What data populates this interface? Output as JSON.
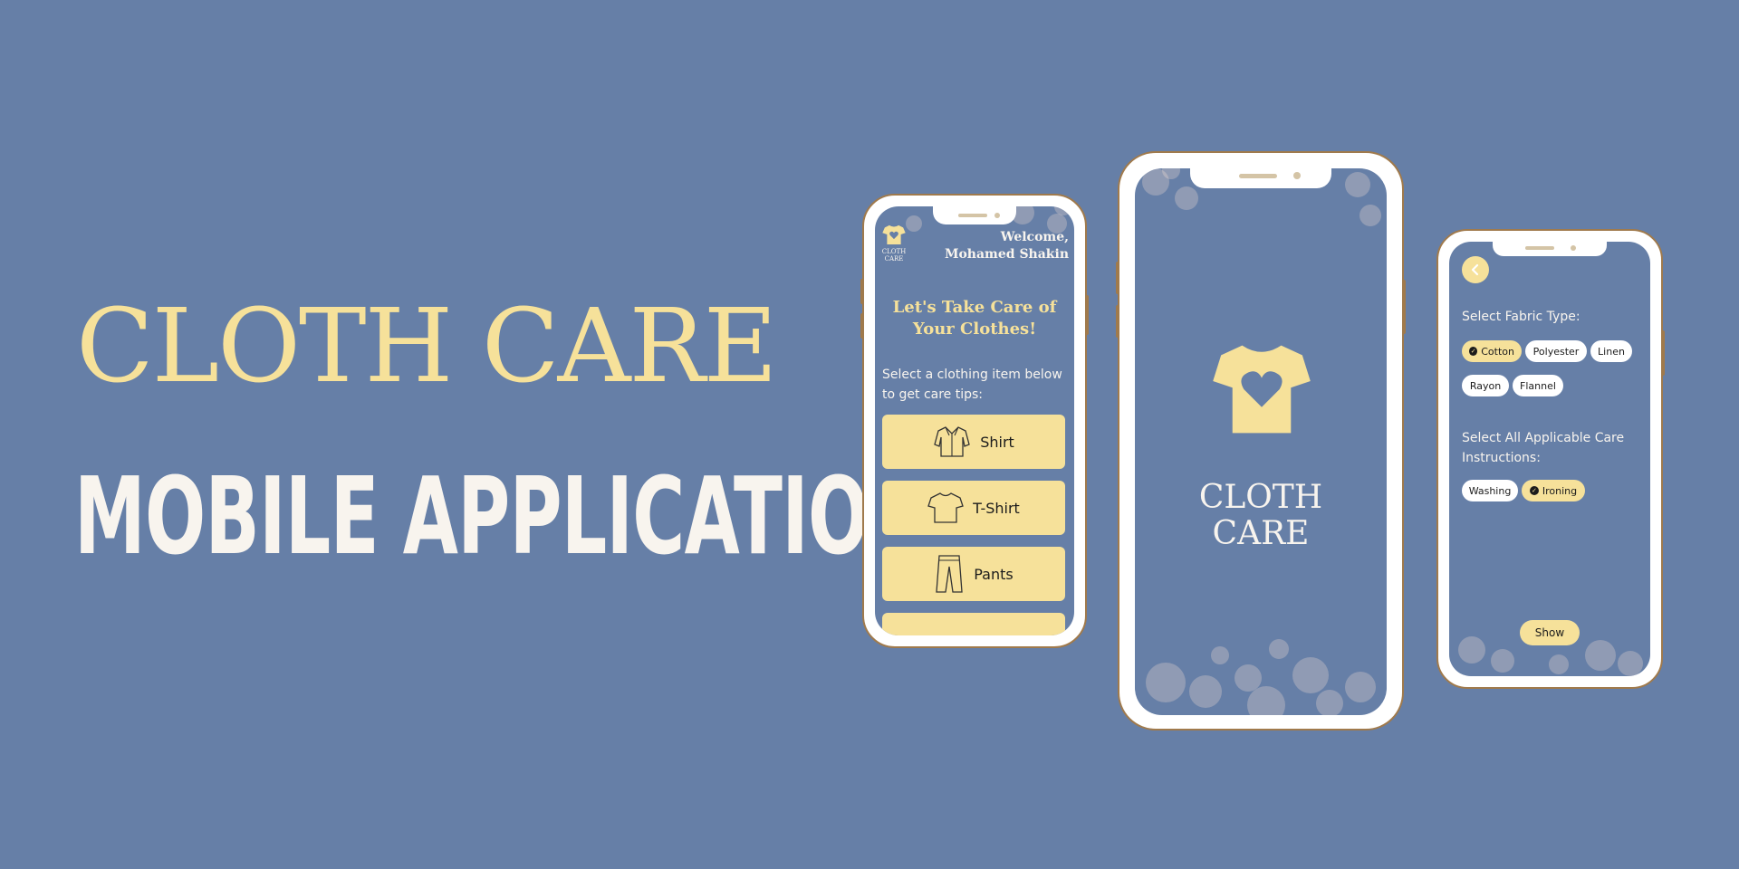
{
  "hero": {
    "title": "CLOTH CARE",
    "subtitle": "MOBILE APPLICATION"
  },
  "home_screen": {
    "logo_line1": "CLOTH",
    "logo_line2": "CARE",
    "welcome_line1": "Welcome,",
    "welcome_line2": "Mohamed Shakin",
    "heading_line1": "Let's Take Care of",
    "heading_line2": "Your Clothes!",
    "prompt": "Select a clothing item below to get care tips:",
    "items": [
      {
        "label": "Shirt",
        "icon": "shirt-icon"
      },
      {
        "label": "T-Shirt",
        "icon": "tshirt-icon"
      },
      {
        "label": "Pants",
        "icon": "pants-icon"
      }
    ]
  },
  "splash_screen": {
    "brand_line1": "CLOTH",
    "brand_line2": "CARE",
    "icon": "tshirt-heart-icon"
  },
  "options_screen": {
    "back_icon": "chevron-left-icon",
    "fabric_label": "Select Fabric Type:",
    "fabrics": [
      {
        "label": "Cotton",
        "selected": true
      },
      {
        "label": "Polyester",
        "selected": false
      },
      {
        "label": "Linen",
        "selected": false
      },
      {
        "label": "Rayon",
        "selected": false
      },
      {
        "label": "Flannel",
        "selected": false
      }
    ],
    "care_label": "Select All Applicable Care Instructions:",
    "care_options": [
      {
        "label": "Washing",
        "selected": false
      },
      {
        "label": "Ironing",
        "selected": true
      }
    ],
    "show_label": "Show"
  },
  "colors": {
    "background": "#667fa7",
    "accent_yellow": "#f6e19a",
    "off_white": "#f8f4ee",
    "frame_border": "#a07a4c"
  }
}
